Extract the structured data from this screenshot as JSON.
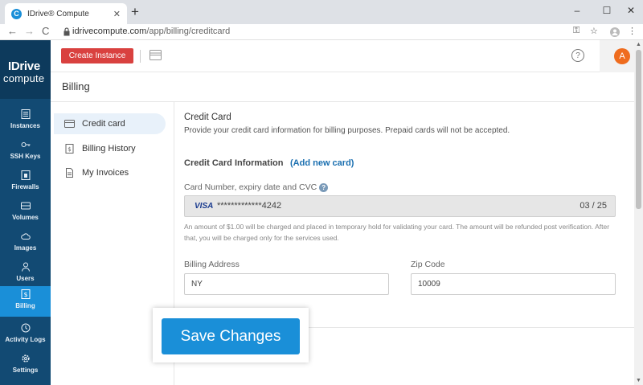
{
  "browser": {
    "tab_title": "IDrive® Compute",
    "favicon_letter": "C",
    "tab_close": "✕",
    "new_tab": "+",
    "url_domain": "idrivecompute.com",
    "url_path": "/app/billing/creditcard",
    "window_minimize": "–",
    "window_maximize": "☐",
    "window_close": "✕",
    "back": "←",
    "forward": "→",
    "reload": "C",
    "key_icon": "⚿",
    "star": "☆",
    "menu": "⋮"
  },
  "logo": {
    "line1": "IDrive",
    "line2": "compute"
  },
  "sidebar": {
    "items": [
      {
        "label": "Instances",
        "icon": "server-icon"
      },
      {
        "label": "SSH Keys",
        "icon": "key-icon"
      },
      {
        "label": "Firewalls",
        "icon": "firewall-icon"
      },
      {
        "label": "Volumes",
        "icon": "drive-icon"
      },
      {
        "label": "Images",
        "icon": "cloud-icon"
      },
      {
        "label": "Users",
        "icon": "user-icon"
      },
      {
        "label": "Billing",
        "icon": "billing-icon",
        "active": true
      },
      {
        "label": "Activity Logs",
        "icon": "history-icon"
      },
      {
        "label": "Settings",
        "icon": "gear-icon"
      }
    ]
  },
  "header": {
    "create_label": "Create Instance",
    "help": "?",
    "avatar_letter": "A"
  },
  "page": {
    "title": "Billing"
  },
  "submenu": {
    "items": [
      {
        "label": "Credit card",
        "icon": "credit-card-icon",
        "active": true
      },
      {
        "label": "Billing History",
        "icon": "document-dollar-icon"
      },
      {
        "label": "My Invoices",
        "icon": "invoice-icon"
      }
    ]
  },
  "credit": {
    "title": "Credit Card",
    "description": "Provide your credit card information for billing purposes. Prepaid cards will not be accepted.",
    "info_title": "Credit Card Information",
    "add_new": "(Add new card)",
    "card_label": "Card Number, expiry date and CVC",
    "card_brand": "VISA",
    "card_number": "*************4242",
    "card_expiry": "03 / 25",
    "note": "An amount of $1.00 will be charged and placed in temporary hold for validating your card. The amount will be refunded post verification. After that, you will be charged only for the services used.",
    "address_label": "Billing Address",
    "address_value": "NY",
    "zip_label": "Zip Code",
    "zip_value": "10009"
  },
  "save": {
    "label": "Save Changes"
  },
  "colors": {
    "accent": "#1a8fd8",
    "sidebar": "#124a73",
    "create": "#d9413f",
    "avatar": "#ef6c1e"
  }
}
